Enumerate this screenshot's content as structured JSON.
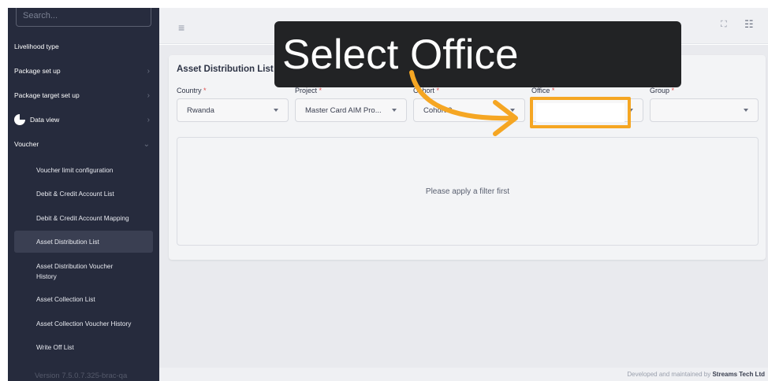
{
  "sidebar": {
    "search_placeholder": "Search...",
    "version": "Version 7.5.0.7.325-brac-qa",
    "items": [
      {
        "label": "Livelihood type"
      },
      {
        "label": "Package set up",
        "chevron": "›"
      },
      {
        "label": "Package target set up",
        "chevron": "›"
      },
      {
        "label": "Data view",
        "chevron": "›",
        "icon": "pie-chart-icon"
      },
      {
        "label": "Voucher",
        "chevron": "⌄"
      }
    ],
    "voucher_sub_items": [
      {
        "label": "Voucher limit configuration"
      },
      {
        "label": "Debit & Credit Account List"
      },
      {
        "label": "Debit & Credit Account Mapping"
      },
      {
        "label": "Asset Distribution List",
        "active": true
      },
      {
        "label": "Asset Distribution Voucher History"
      },
      {
        "label": "Asset Collection List"
      },
      {
        "label": "Asset Collection Voucher History"
      },
      {
        "label": "Write Off List"
      }
    ]
  },
  "topbar": {
    "menu_icon": "≡",
    "expand_icon": "⛶",
    "apps_icon": "☷"
  },
  "page": {
    "title": "Asset Distribution List",
    "filters": {
      "country": {
        "label": "Country",
        "value": "Rwanda"
      },
      "project": {
        "label": "Project",
        "value": "Master Card AIM Pro..."
      },
      "cohort": {
        "label": "Cohort",
        "value": "Cohort 3"
      },
      "office": {
        "label": "Office",
        "value": ""
      },
      "group": {
        "label": "Group",
        "value": ""
      }
    },
    "required_marker": "*",
    "empty_message": "Please apply a filter first"
  },
  "footer": {
    "prefix": "Developed and maintained by",
    "company": "Streams Tech Ltd"
  },
  "overlay": {
    "tooltip_text": "Select Office",
    "highlight_color": "#f5a623"
  },
  "colors": {
    "sidebar_bg": "#262b3d",
    "accent": "#f5a623",
    "required": "#e04a4a"
  }
}
